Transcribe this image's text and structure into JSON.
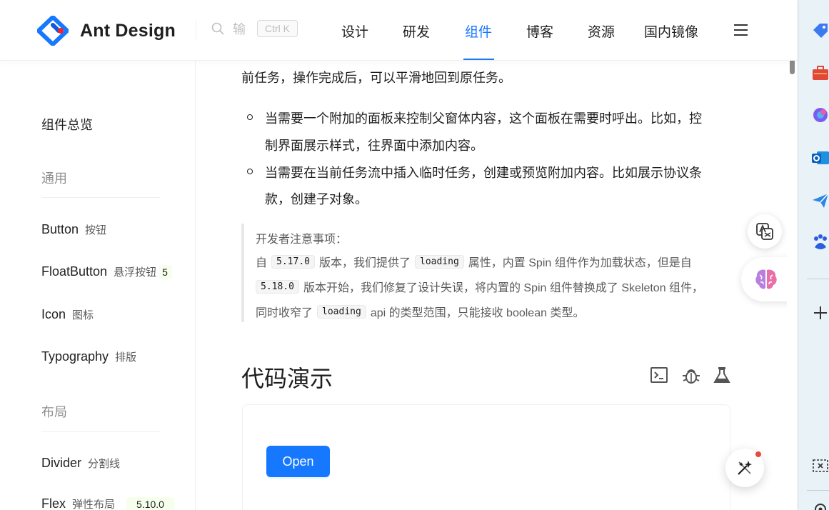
{
  "header": {
    "logo_text": "Ant Design",
    "search_placeholder": "输",
    "search_shortcut": "Ctrl K",
    "nav": [
      {
        "label": "设计"
      },
      {
        "label": "研发"
      },
      {
        "label": "组件",
        "active": true
      },
      {
        "label": "博客"
      },
      {
        "label": "资源"
      },
      {
        "label": "国内镜像"
      }
    ]
  },
  "sidebar": {
    "overview": "组件总览",
    "groups": [
      {
        "title": "通用",
        "items": [
          {
            "label": "Button",
            "sub": "按钮"
          },
          {
            "label": "FloatButton",
            "sub": "悬浮按钮",
            "tag": "5"
          },
          {
            "label": "Icon",
            "sub": "图标"
          },
          {
            "label": "Typography",
            "sub": "排版"
          }
        ]
      },
      {
        "title": "布局",
        "items": [
          {
            "label": "Divider",
            "sub": "分割线"
          },
          {
            "label": "Flex",
            "sub": "弹性布局",
            "tag": "5.10.0"
          }
        ]
      }
    ]
  },
  "content": {
    "top_line": "前任务，操作完成后，可以平滑地回到原任务。",
    "bullets": [
      [
        "当需要一个附加的面板来控制父窗体内容，这个面板在需要时呼出。比如，控",
        "制界面展示样式，往界面中添加内容。"
      ],
      [
        "当需要在当前任务流中插入临时任务，创建或预览附加内容。比如展示协议条",
        "款，创建子对象。"
      ]
    ],
    "note": {
      "title": "开发者注意事项：",
      "l1_a": "自",
      "l1_code1": "5.17.0",
      "l1_b": "版本，我们提供了",
      "l1_code2": "loading",
      "l1_c": "属性，内置 Spin 组件作为加载状态，但是自",
      "l2_code": "5.18.0",
      "l2_a": "版本开始，我们修复了设计失误，将内置的 Spin 组件替换成了 Skeleton 组件，",
      "l3_a": "同时收窄了",
      "l3_code": "loading",
      "l3_b": "api 的类型范围，只能接收 boolean 类型。"
    },
    "section_title": "代码演示",
    "demo_button": "Open"
  },
  "colors": {
    "primary": "#1677ff",
    "tag_bg": "#f6ffed",
    "panel_bg": "#e8f2f7"
  },
  "icons": [
    "search-icon",
    "menu-icon",
    "terminal-icon",
    "bug-icon",
    "flask-icon",
    "translate-icon",
    "brain-icon",
    "ai-magic-icon"
  ]
}
